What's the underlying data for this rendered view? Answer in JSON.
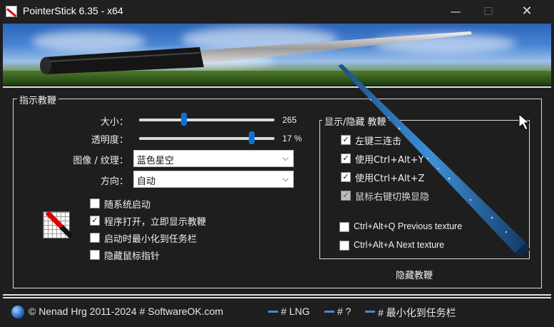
{
  "window": {
    "title": "PointerStick 6.35 - x64"
  },
  "left_group": {
    "title": "指示教鞭",
    "size": {
      "label": "大小：",
      "value": "265",
      "fraction": 0.33
    },
    "transparency": {
      "label": "透明度：",
      "value": "17 %",
      "fraction": 0.83
    },
    "texture": {
      "label": "图像 / 纹理：",
      "selected": "蓝色星空"
    },
    "direction": {
      "label": "方向：",
      "selected": "自动"
    },
    "options": [
      {
        "label": "随系统启动",
        "checked": false
      },
      {
        "label": "程序打开，立即显示教鞭",
        "checked": true
      },
      {
        "label": "启动时最小化到任务栏",
        "checked": false
      },
      {
        "label": "隐藏鼠标指针",
        "checked": false
      }
    ]
  },
  "right_group": {
    "title": "显示/隐藏 教鞭",
    "options": [
      {
        "label": "左键三连击",
        "checked": true,
        "dim": false
      },
      {
        "label": "使用Ctrl+Alt+Y",
        "checked": true,
        "dim": false
      },
      {
        "label": "使用Ctrl+Alt+Z",
        "checked": true,
        "dim": false
      },
      {
        "label": "鼠标右键切换显隐",
        "checked": true,
        "dim": true
      },
      {
        "label": "Ctrl+Alt+Q Previous texture",
        "checked": false,
        "dim": false
      },
      {
        "label": "Ctrl+Alt+A Next texture",
        "checked": false,
        "dim": false
      }
    ]
  },
  "hide_pointer_button": "隐藏教鞭",
  "footer": {
    "copyright": "© Nenad Hrg 2011-2024 # SoftwareOK.com",
    "lng": "# LNG",
    "help": "# ?",
    "minimize": "# 最小化到任务栏"
  },
  "icons": {
    "close": "close-icon",
    "minimize": "minimize-icon",
    "maximize": "maximize-icon",
    "globe": "globe-icon",
    "chevron": "chevron-down-icon",
    "check": "check-icon"
  },
  "colors": {
    "accent": "#0a74d4",
    "background": "#1e1e1e",
    "titlebar": "#202020"
  }
}
